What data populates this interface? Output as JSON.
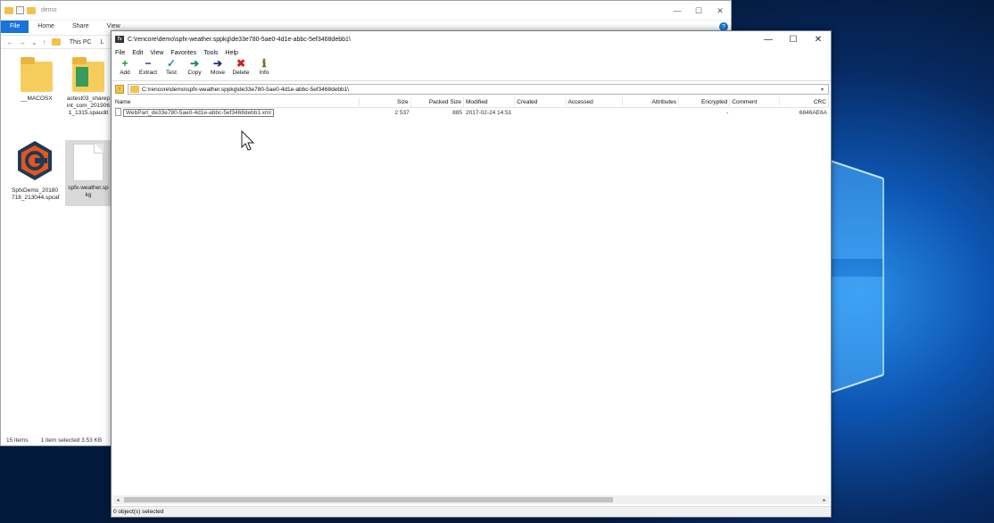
{
  "explorer": {
    "title": "demo",
    "ribbon_tabs": [
      "File",
      "Home",
      "Share",
      "View"
    ],
    "address": {
      "crumb1": "This PC",
      "crumb2": "L"
    },
    "items": [
      {
        "name": "__MACOSX",
        "icon": "folder-icon"
      },
      {
        "name": "actest03_sharepoint_com_20190611_1315.spaudit",
        "display": "actest03_sharep\nint_com_201906\n1_1315.spaudit",
        "icon": "zip-folder-icon"
      },
      {
        "name": "SpfxDemo_20180718_213044.spcaf",
        "display": "SpfxDemo_20180\n718_213044.spcaf",
        "icon": "spcaf-icon"
      },
      {
        "name": "spfx-weather.sppkg",
        "display": "spfx-weather.sp\nkg",
        "icon": "document-icon"
      }
    ],
    "status": {
      "items": "15 items",
      "selected": "1 item selected  3.53 KB"
    }
  },
  "sevenzip": {
    "title": "C:\\rencore\\demo\\spfx-weather.sppkg\\de33e780-5ae0-4d1e-abbc-5ef3468debb1\\",
    "menu": [
      "File",
      "Edit",
      "View",
      "Favorites",
      "Tools",
      "Help"
    ],
    "toolbar": [
      {
        "label": "Add",
        "icon": "add-icon",
        "glyph": "+",
        "color": "#1a9a2a"
      },
      {
        "label": "Extract",
        "icon": "extract-icon",
        "glyph": "−",
        "color": "#1b2f8a"
      },
      {
        "label": "Test",
        "icon": "test-icon",
        "glyph": "✓",
        "color": "#1a8fb0"
      },
      {
        "label": "Copy",
        "icon": "copy-icon",
        "glyph": "➔",
        "color": "#1a8a5a"
      },
      {
        "label": "Move",
        "icon": "move-icon",
        "glyph": "➔",
        "color": "#1b2f8a"
      },
      {
        "label": "Delete",
        "icon": "delete-icon",
        "glyph": "✖",
        "color": "#d02020"
      },
      {
        "label": "Info",
        "icon": "info-icon",
        "glyph": "ℹ",
        "color": "#7a6a10"
      }
    ],
    "path": "C:\\rencore\\demo\\spfx-weather.sppkg\\de33e780-5ae0-4d1e-abbc-5ef3468debb1\\",
    "columns": [
      "Name",
      "Size",
      "Packed Size",
      "Modified",
      "Created",
      "Accessed",
      "Attributes",
      "Encrypted",
      "Comment",
      "CRC"
    ],
    "rows": [
      {
        "name": "WebPart_de33e780-5ae0-4d1e-abbc-5ef3468debb1.xml",
        "size": "2 537",
        "packed": "885",
        "modified": "2017-02-24 14:51",
        "created": "",
        "accessed": "",
        "attributes": "",
        "encrypted": "-",
        "comment": "",
        "crc": "6846AE6A"
      }
    ],
    "status": "0 object(s) selected"
  }
}
